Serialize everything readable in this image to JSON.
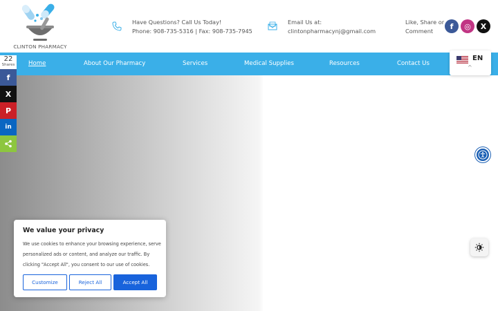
{
  "brand": {
    "name": "CLINTON PHARMACY"
  },
  "contact": {
    "phone_heading": "Have Questions? Call Us Today!",
    "phone_line": "Phone: 908-735-5316 | Fax: 908-735-7945",
    "email_heading": "Email Us at:",
    "email_line": "clintonpharmacynj@gmail.com",
    "social_text": "Like, Share or Comment"
  },
  "social": [
    {
      "icon": "facebook-icon",
      "glyph": "f",
      "color": "#3b5998"
    },
    {
      "icon": "instagram-icon",
      "glyph": "◎",
      "color": "#c13584"
    },
    {
      "icon": "x-icon",
      "glyph": "X",
      "color": "#111111"
    }
  ],
  "nav": {
    "items": [
      {
        "label": "Home",
        "active": true
      },
      {
        "label": "About Our Pharmacy"
      },
      {
        "label": "Services"
      },
      {
        "label": "Medical Supplies"
      },
      {
        "label": "Resources"
      },
      {
        "label": "Contact Us"
      }
    ],
    "background": "#3aafe8"
  },
  "language": {
    "code": "EN",
    "caret": "^"
  },
  "share_bar": {
    "count": "22",
    "count_label": "Shares",
    "buttons": [
      {
        "icon": "facebook-icon",
        "glyph": "f",
        "color": "#3b5998"
      },
      {
        "icon": "x-icon",
        "glyph": "X",
        "color": "#111111"
      },
      {
        "icon": "pinterest-icon",
        "glyph": "P",
        "color": "#cb2027"
      },
      {
        "icon": "linkedin-icon",
        "glyph": "in",
        "color": "#0a66c2"
      },
      {
        "icon": "share-icon",
        "glyph": "<",
        "color": "#8dc63f"
      }
    ]
  },
  "cookie": {
    "title": "We value your privacy",
    "body": "We use cookies to enhance your browsing experience, serve personalized ads or content, and analyze our traffic. By clicking \"Accept All\", you consent to our use of cookies.",
    "customize": "Customize",
    "reject": "Reject All",
    "accept": "Accept All",
    "accent": "#1863dc"
  }
}
